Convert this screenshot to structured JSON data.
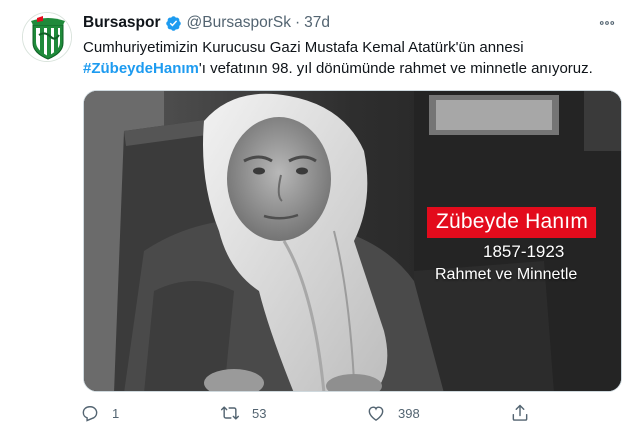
{
  "account": {
    "name": "Bursaspor",
    "handle": "@BursasporSk",
    "separator": "·",
    "time": "37d"
  },
  "tweet": {
    "line1": "Cumhuriyetimizin Kurucusu Gazi Mustafa Kemal Atatürk'ün annesi",
    "hashtag": "#ZübeydeHanım",
    "line2_rest": "'ı vefatının 98. yıl dönümünde rahmet ve minnetle anıyoruz."
  },
  "media": {
    "caption_name": "Zübeyde Hanım",
    "caption_years": "1857-1923",
    "caption_motto": "Rahmet ve Minnetle"
  },
  "actions": {
    "replies": "1",
    "retweets": "53",
    "likes": "398"
  },
  "icons": {
    "avatar": "bursaspor-crest-icon",
    "verified": "verified-badge-icon",
    "more": "more-options-icon",
    "reply": "reply-icon",
    "retweet": "retweet-icon",
    "like": "heart-icon",
    "share": "share-icon"
  },
  "colors": {
    "accent": "#1d9bf0",
    "caption_red": "#e30b1c",
    "club_green": "#1f8a3a",
    "muted": "#536471"
  }
}
